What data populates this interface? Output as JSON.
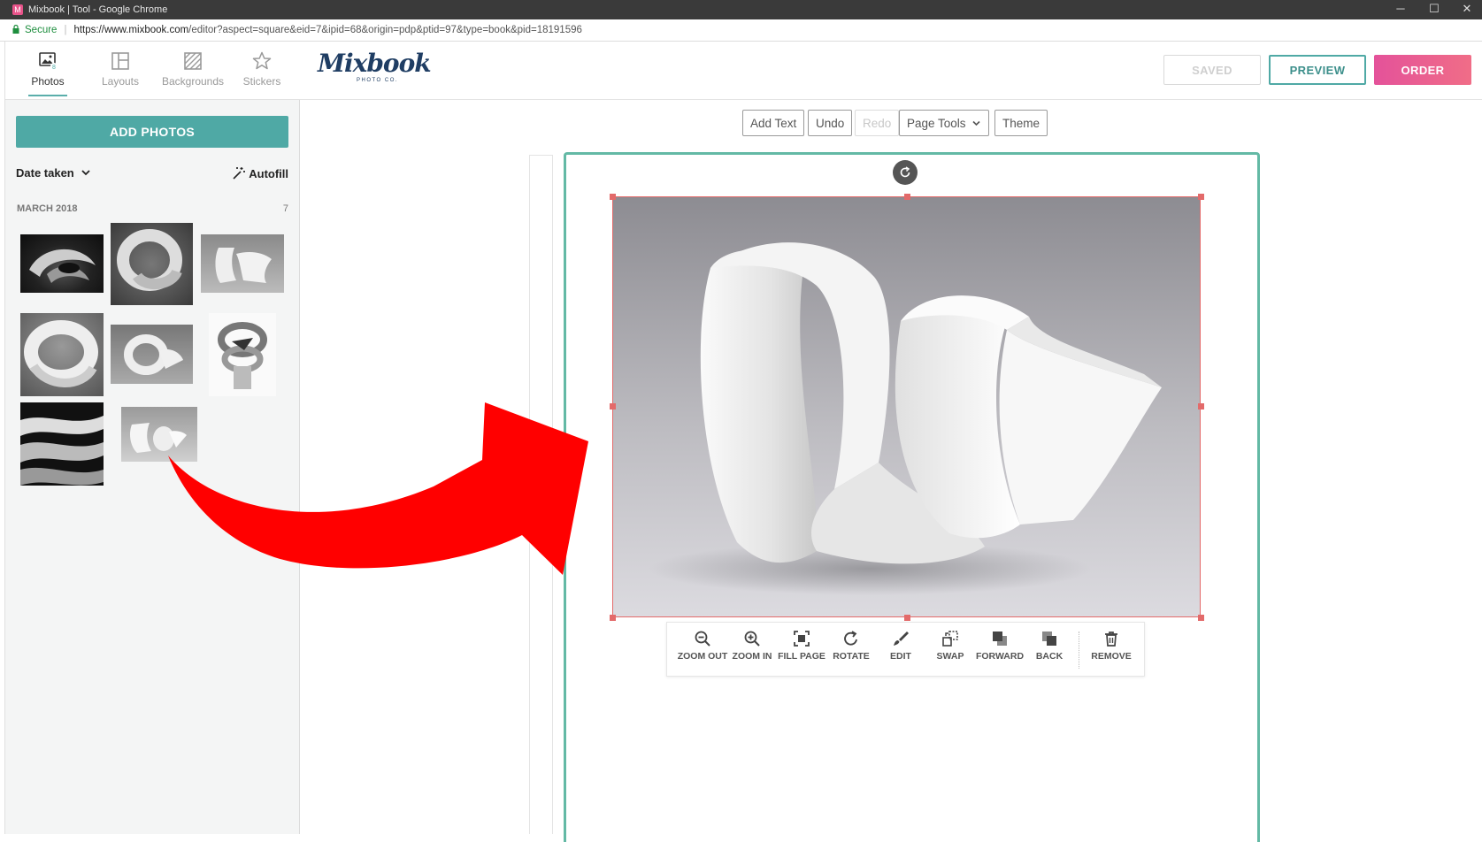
{
  "window": {
    "title": "Mixbook | Tool - Google Chrome",
    "favicon_letter": "M",
    "controls": {
      "minimize": "─",
      "maximize": "☐",
      "close": "✕"
    }
  },
  "addressbar": {
    "secure_label": "Secure",
    "url_domain": "https://www.mixbook.com",
    "url_path": "/editor?aspect=square&eid=7&ipid=68&origin=pdp&ptid=97&type=book&pid=18191596"
  },
  "sidebar": {
    "tabs": [
      {
        "label": "Photos",
        "badge": "8",
        "icon": "photos-icon"
      },
      {
        "label": "Layouts",
        "icon": "layouts-icon"
      },
      {
        "label": "Backgrounds",
        "icon": "backgrounds-icon"
      },
      {
        "label": "Stickers",
        "icon": "star-icon"
      }
    ],
    "add_photos_label": "ADD PHOTOS",
    "sort_label": "Date taken",
    "autofill_label": "Autofill",
    "group": {
      "month": "MARCH 2018",
      "count": "7"
    }
  },
  "header": {
    "logo_brand": "Mixbook",
    "logo_sub": "PHOTO CO.",
    "saved_label": "SAVED",
    "preview_label": "PREVIEW",
    "order_label": "ORDER"
  },
  "toolbar": {
    "add_text": "Add Text",
    "undo": "Undo",
    "redo": "Redo",
    "page_tools": "Page Tools",
    "theme": "Theme"
  },
  "photo_tools": {
    "zoom_out": "ZOOM OUT",
    "zoom_in": "ZOOM IN",
    "fill_page": "FILL PAGE",
    "rotate": "ROTATE",
    "edit": "EDIT",
    "swap": "SWAP",
    "forward": "FORWARD",
    "back": "BACK",
    "remove": "REMOVE"
  },
  "colors": {
    "accent_teal": "#4fa9a5",
    "order_pink": "#e4529a",
    "selection_red": "#e36a6a",
    "page_border": "#63b9a5",
    "annotation_arrow": "#ff0000"
  }
}
